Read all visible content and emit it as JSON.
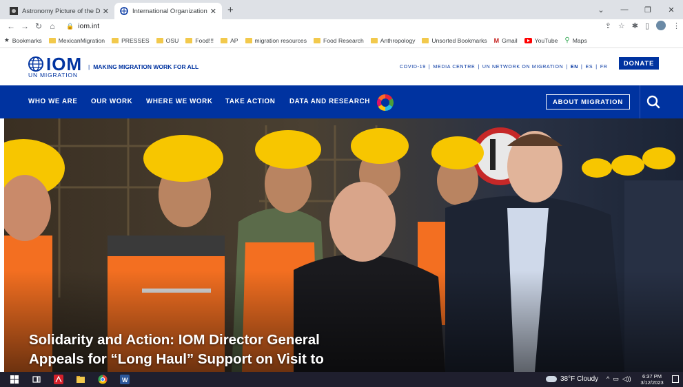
{
  "browser": {
    "tabs": [
      {
        "title": "Astronomy Picture of the Day",
        "active": false
      },
      {
        "title": "International Organization for M",
        "active": true
      }
    ],
    "url": "iom.int",
    "bookmarks": [
      {
        "label": "Bookmarks",
        "icon": "star-icon"
      },
      {
        "label": "MexicanMigration",
        "icon": "folder-icon"
      },
      {
        "label": "PRESSES",
        "icon": "folder-icon"
      },
      {
        "label": "OSU",
        "icon": "folder-icon"
      },
      {
        "label": "Food!!!",
        "icon": "folder-icon"
      },
      {
        "label": "AP",
        "icon": "folder-icon"
      },
      {
        "label": "migration resources",
        "icon": "folder-icon"
      },
      {
        "label": "Food Research",
        "icon": "folder-icon"
      },
      {
        "label": "Anthropology",
        "icon": "folder-icon"
      },
      {
        "label": "Unsorted Bookmarks",
        "icon": "folder-icon"
      },
      {
        "label": "Gmail",
        "icon": "gmail-icon"
      },
      {
        "label": "YouTube",
        "icon": "youtube-icon"
      },
      {
        "label": "Maps",
        "icon": "maps-icon"
      }
    ]
  },
  "site": {
    "logo_text": "IOM",
    "logo_subtext": "UN MIGRATION",
    "tagline": "MAKING MIGRATION WORK FOR ALL",
    "top_links": [
      "COVID-19",
      "MEDIA CENTRE",
      "UN NETWORK ON MIGRATION"
    ],
    "languages": [
      "EN",
      "ES",
      "FR"
    ],
    "donate_label": "DONATE",
    "nav": [
      "WHO WE ARE",
      "OUR WORK",
      "WHERE WE WORK",
      "TAKE ACTION",
      "DATA AND RESEARCH"
    ],
    "about_label": "ABOUT MIGRATION",
    "hero_headline_line1": "Solidarity and Action: IOM Director General",
    "hero_headline_line2": "Appeals for “Long Haul” Support on Visit to"
  },
  "taskbar": {
    "weather": "38°F  Cloudy",
    "time": "6:37 PM",
    "date": "3/12/2023"
  },
  "colors": {
    "iom_blue": "#0033a0",
    "hi_vis_orange": "#f36f21",
    "helmet_yellow": "#f7c600"
  }
}
